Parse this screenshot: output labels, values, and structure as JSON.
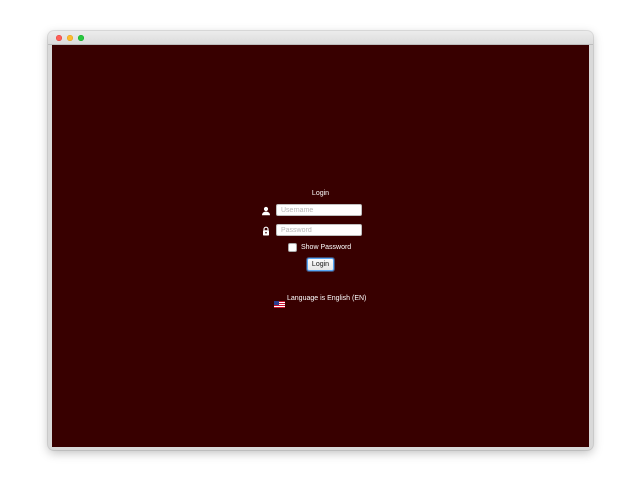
{
  "window": {
    "controls": [
      "close",
      "minimize",
      "zoom"
    ]
  },
  "login": {
    "title": "Login",
    "username": {
      "icon": "user-icon",
      "placeholder": "Username",
      "value": ""
    },
    "password": {
      "icon": "lock-icon",
      "placeholder": "Password",
      "value": ""
    },
    "show_password": {
      "label": "Show Password",
      "checked": false
    },
    "button_label": "Login"
  },
  "language": {
    "icon": "us-flag-icon",
    "label": "Language is English (EN)"
  },
  "colors": {
    "background": "#380000",
    "text": "#ffffff",
    "focus_ring": "#57a6f5"
  }
}
